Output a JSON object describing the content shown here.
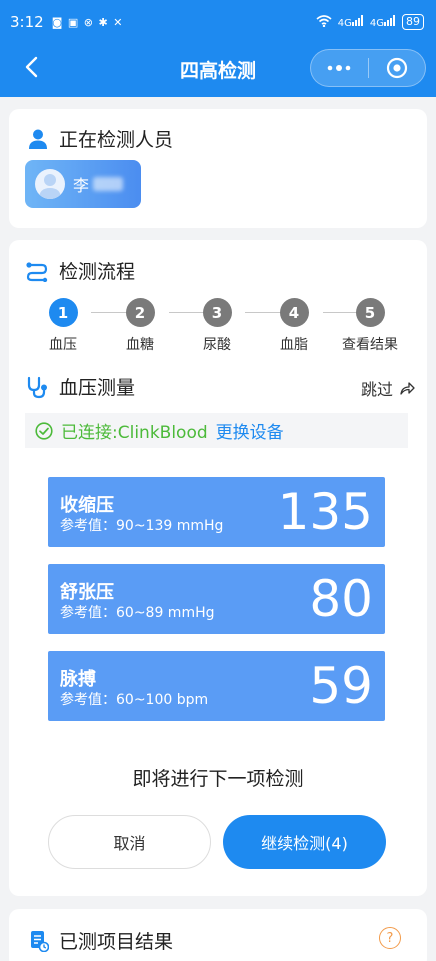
{
  "status_bar": {
    "time": "3:12",
    "left_icons": [
      "notification-icon",
      "nfc-icon",
      "alarm-icon",
      "bluetooth-icon",
      "mute-icon"
    ],
    "signal_label": "4G",
    "battery": "89"
  },
  "nav": {
    "title": "四高检测",
    "capsule_menu": "•••"
  },
  "person": {
    "heading": "正在检测人员",
    "name": "李"
  },
  "flow": {
    "heading": "检测流程",
    "steps": [
      {
        "num": "1",
        "label": "血压"
      },
      {
        "num": "2",
        "label": "血糖"
      },
      {
        "num": "3",
        "label": "尿酸"
      },
      {
        "num": "4",
        "label": "血脂"
      },
      {
        "num": "5",
        "label": "查看结果"
      }
    ],
    "active_step": 1
  },
  "bp": {
    "heading": "血压测量",
    "skip": "跳过",
    "connected": "已连接:ClinkBlood",
    "change_device": "更换设备"
  },
  "metrics": [
    {
      "name": "收缩压",
      "ref": "参考值：90~139 mmHg",
      "value": "135"
    },
    {
      "name": "舒张压",
      "ref": "参考值：60~89 mmHg",
      "value": "80"
    },
    {
      "name": "脉搏",
      "ref": "参考值：60~100 bpm",
      "value": "59"
    }
  ],
  "next": {
    "text": "即将进行下一项检测",
    "cancel": "取消",
    "continue": "继续检测(4)"
  },
  "results": {
    "heading": "已测项目结果",
    "help": "?"
  },
  "colors": {
    "primary": "#1e8af0",
    "metric_bg": "#5a9cf5",
    "connected": "#4cba3a",
    "help": "#f29b4b"
  }
}
